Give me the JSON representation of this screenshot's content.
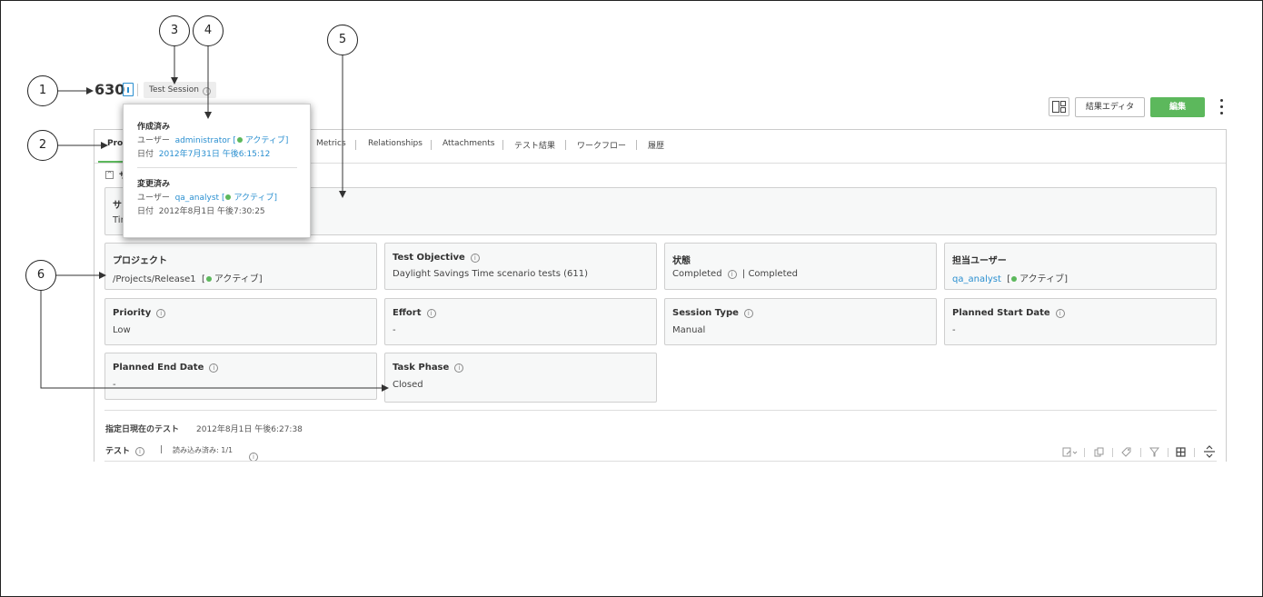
{
  "header": {
    "item_id": "630",
    "item_type": "Test Session",
    "info_glyph": "i",
    "result_editor_label": "結果エディタ",
    "edit_label": "編集"
  },
  "tabs": [
    {
      "label": "Properties",
      "visible_label": "Prop"
    },
    {
      "label": "Metrics"
    },
    {
      "label": "Relationships"
    },
    {
      "label": "Attachments"
    },
    {
      "label": "テスト結果"
    },
    {
      "label": "ワークフロー"
    },
    {
      "label": "履歴"
    }
  ],
  "section": {
    "collapse_glyph": "^",
    "label": "サ",
    "summary_box_label": "サ",
    "summary_box_value": "Tin"
  },
  "fields": {
    "project": {
      "label": "プロジェクト",
      "value": "/Projects/Release1",
      "status": "アクティブ"
    },
    "test_objective": {
      "label": "Test Objective",
      "value": "Daylight Savings Time scenario tests (611)"
    },
    "state": {
      "label": "状態",
      "value": "Completed",
      "value2": "| Completed"
    },
    "assigned_user": {
      "label": "担当ユーザー",
      "value": "qa_analyst",
      "status": "アクティブ"
    },
    "priority": {
      "label": "Priority",
      "value": "Low"
    },
    "effort": {
      "label": "Effort",
      "value": "-"
    },
    "session_type": {
      "label": "Session Type",
      "value": "Manual"
    },
    "planned_start_date": {
      "label": "Planned Start Date",
      "value": "-"
    },
    "planned_end_date": {
      "label": "Planned End Date",
      "value": "-"
    },
    "task_phase": {
      "label": "Task Phase",
      "value": "Closed"
    }
  },
  "tests": {
    "as_of_label": "指定日現在のテスト",
    "as_of_value": "2012年8月1日 午後6:27:38",
    "label": "テスト",
    "separator": "|",
    "loaded": "読み込み済み: 1/1"
  },
  "popover": {
    "created_heading": "作成済み",
    "created_user_label": "ユーザー",
    "created_user": "administrator",
    "created_status": "アクティブ",
    "created_date_label": "日付",
    "created_date": "2012年7月31日 午後6:15:12",
    "modified_heading": "変更済み",
    "modified_user_label": "ユーザー",
    "modified_user": "qa_analyst",
    "modified_status": "アクティブ",
    "modified_date_label": "日付",
    "modified_date": "2012年8月1日 午後7:30:25"
  },
  "callouts": [
    "1",
    "2",
    "3",
    "4",
    "5",
    "6"
  ],
  "icons": [
    "document-icon",
    "info-icon",
    "layout-toggle-icon",
    "kebab-menu-icon",
    "collapse-icon",
    "edit-icon",
    "copy-icon",
    "tag-icon",
    "filter-icon",
    "grid-icon",
    "expand-icon"
  ],
  "colors": {
    "accent_green": "#5cb85c",
    "link_blue": "#2a8fd0"
  }
}
